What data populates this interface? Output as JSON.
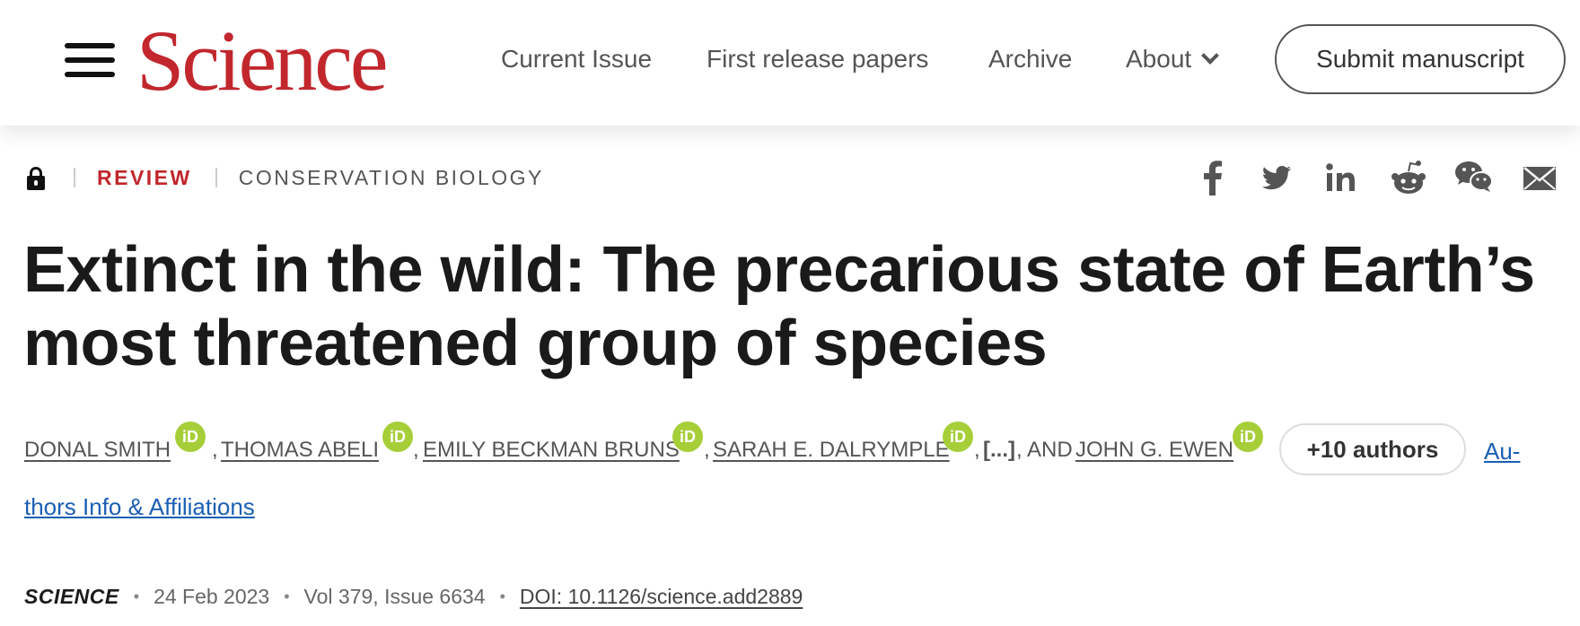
{
  "header": {
    "logo": "Science",
    "nav": {
      "current_issue": "Current Issue",
      "first_release": "First release papers",
      "archive": "Archive",
      "about": "About"
    },
    "submit_label": "Submit manuscript"
  },
  "article": {
    "type": "REVIEW",
    "subject": "CONSERVATION BIOLOGY",
    "title_line1": "Extinct in the wild: The precarious state of Earth’s",
    "title_line2": "most threatened group of species",
    "share_icons": [
      "facebook-icon",
      "twitter-icon",
      "linkedin-icon",
      "reddit-icon",
      "wechat-icon",
      "email-icon"
    ],
    "authors": [
      "DONAL SMITH",
      "THOMAS ABELI",
      "EMILY BECKMAN BRUNS",
      "SARAH E. DALRYMPLE",
      "JOHN G. EWEN"
    ],
    "orcid_label": "iD",
    "separator": ",",
    "ellipsis": "[...]",
    "and_text": ", AND",
    "more_authors_label": "+10 authors",
    "affiliations_label_part1": "Au-",
    "affiliations_label_part2": "thors Info & Affiliations",
    "citation": {
      "journal": "SCIENCE",
      "date": "24 Feb 2023",
      "volume": "Vol 379, Issue 6634",
      "doi": "DOI: 10.1126/science.add2889",
      "bullet": "•"
    }
  },
  "colors": {
    "brand_red": "#c1272d",
    "orcid_green": "#a6ce39",
    "link_blue": "#1a5fb4"
  }
}
